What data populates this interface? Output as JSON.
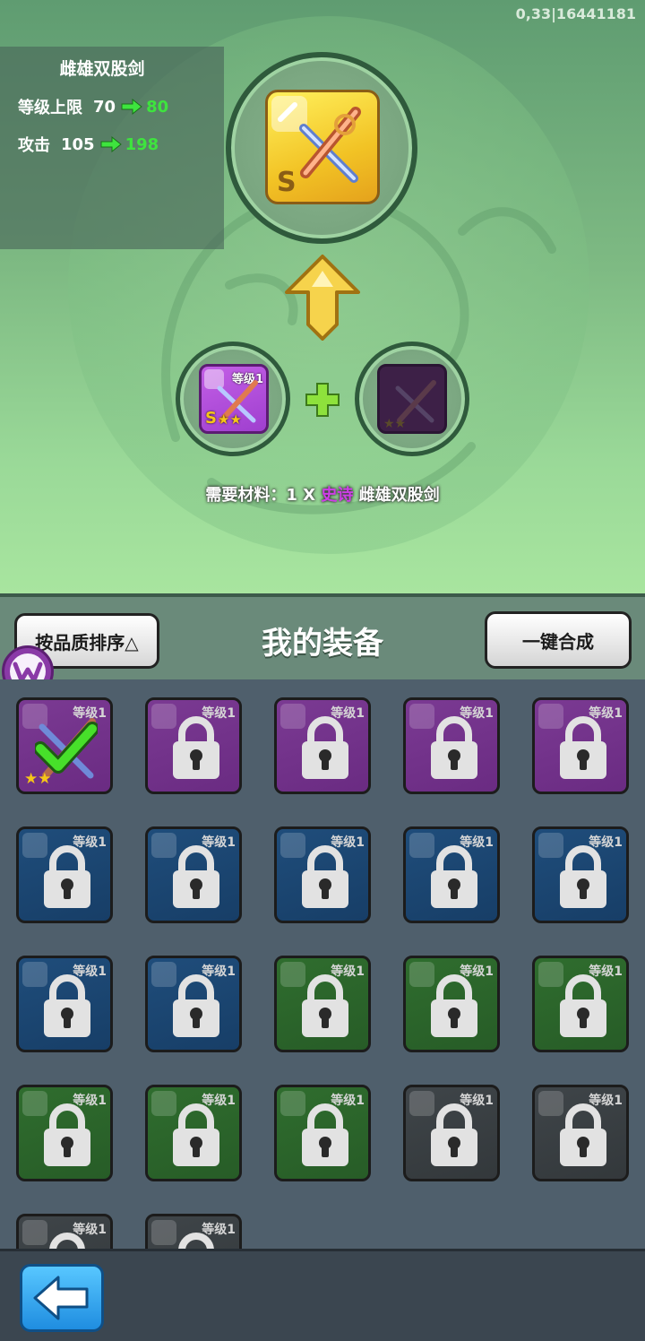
{
  "version_text": "0,33|16441181",
  "weapon": {
    "name": "雌雄双股剑",
    "grade": "S",
    "level_label": "等级上限",
    "level_old": "70",
    "level_new": "80",
    "attack_label": "攻击",
    "attack_old": "105",
    "attack_new": "198"
  },
  "material": {
    "level_tag": "等级1",
    "grade": "S",
    "stars": "★★"
  },
  "requirement": {
    "prefix": "需要材料：",
    "count": "1 X",
    "rarity": "史诗",
    "item": "雌雄双股剑"
  },
  "panel": {
    "sort_label": "按品质排序△",
    "title": "我的装备",
    "merge_label": "一键合成"
  },
  "colors": {
    "gain": "#3ee43e",
    "epic": "#cf3ee8",
    "accent": "#1f8de0"
  },
  "equipment": [
    {
      "rarity": "purple",
      "tag": "等级1",
      "state": "selected",
      "stars": "★★"
    },
    {
      "rarity": "purple",
      "tag": "等级1",
      "state": "locked"
    },
    {
      "rarity": "purple",
      "tag": "等级1",
      "state": "locked"
    },
    {
      "rarity": "purple",
      "tag": "等级1",
      "state": "locked"
    },
    {
      "rarity": "purple",
      "tag": "等级1",
      "state": "locked"
    },
    {
      "rarity": "blue",
      "tag": "等级1",
      "state": "locked"
    },
    {
      "rarity": "blue",
      "tag": "等级1",
      "state": "locked"
    },
    {
      "rarity": "blue",
      "tag": "等级1",
      "state": "locked"
    },
    {
      "rarity": "blue",
      "tag": "等级1",
      "state": "locked"
    },
    {
      "rarity": "blue",
      "tag": "等级1",
      "state": "locked"
    },
    {
      "rarity": "blue",
      "tag": "等级1",
      "state": "locked"
    },
    {
      "rarity": "blue",
      "tag": "等级1",
      "state": "locked"
    },
    {
      "rarity": "green",
      "tag": "等级1",
      "state": "locked"
    },
    {
      "rarity": "green",
      "tag": "等级1",
      "state": "locked"
    },
    {
      "rarity": "green",
      "tag": "等级1",
      "state": "locked"
    },
    {
      "rarity": "green",
      "tag": "等级1",
      "state": "locked"
    },
    {
      "rarity": "green",
      "tag": "等级1",
      "state": "locked"
    },
    {
      "rarity": "green",
      "tag": "等级1",
      "state": "locked"
    },
    {
      "rarity": "gray",
      "tag": "等级1",
      "state": "locked"
    },
    {
      "rarity": "gray",
      "tag": "等级1",
      "state": "locked"
    },
    {
      "rarity": "gray",
      "tag": "等级1",
      "state": "locked"
    },
    {
      "rarity": "gray",
      "tag": "等级1",
      "state": "locked"
    }
  ]
}
